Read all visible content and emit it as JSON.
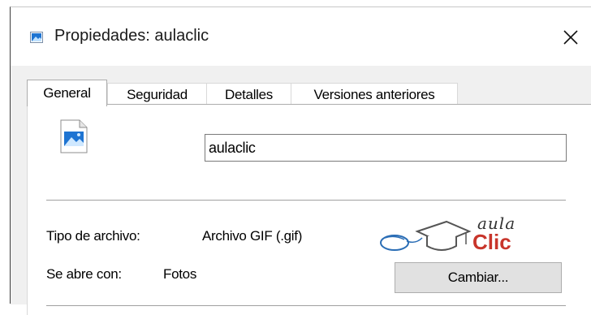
{
  "window": {
    "title": "Propiedades: aulaclic"
  },
  "tabs": [
    {
      "label": "General",
      "active": true
    },
    {
      "label": "Seguridad",
      "active": false
    },
    {
      "label": "Detalles",
      "active": false
    },
    {
      "label": "Versiones anteriores",
      "active": false
    }
  ],
  "general": {
    "file_name": "aulaclic",
    "file_type_label": "Tipo de archivo:",
    "file_type_value": "Archivo GIF (.gif)",
    "opens_with_label": "Se abre con:",
    "opens_with_value": "Fotos",
    "change_button": "Cambiar..."
  },
  "logo": {
    "top_text": "aula",
    "bottom_text": "Clic"
  },
  "icons": {
    "title": "image-file-icon",
    "file": "image-file-icon",
    "close": "close-icon",
    "logo": "graduation-cap-mouse-icon"
  },
  "colors": {
    "accent_blue": "#1e74d2",
    "logo_red": "#c8352b",
    "button_face": "#e1e1e1"
  }
}
